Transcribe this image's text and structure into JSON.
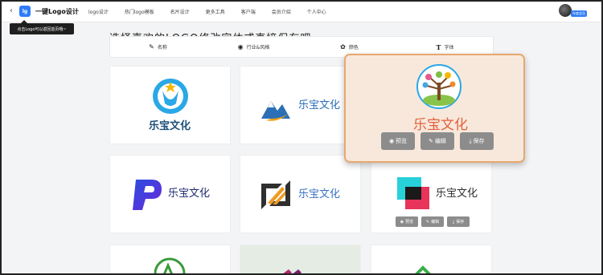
{
  "header": {
    "back_icon": "chevron-left-icon",
    "brand_badge": "lg",
    "brand": "一键Logo设计",
    "nav": [
      "logo设计",
      "热门logo模板",
      "名片设计",
      "更多工具",
      "客户端",
      "会员介绍",
      "个人中心"
    ],
    "vip_badge": "年度会员"
  },
  "tooltip": "点击Logo可以返回首页哦~",
  "heading": "选择喜欢的LOGO修改字体或直接保存吧",
  "tabs": [
    {
      "icon": "pen-icon",
      "label": "名称"
    },
    {
      "icon": "compass-icon",
      "label": "行业&风格"
    },
    {
      "icon": "palette-icon",
      "label": "颜色"
    },
    {
      "icon": "text-icon",
      "label": "字体"
    }
  ],
  "cards": [
    {
      "name": "乐宝文化",
      "color": "#1e4f7a"
    },
    {
      "name": "乐宝文化",
      "color": "#2b6fb6"
    },
    {
      "name": "乐宝文化",
      "color": "#e2613a"
    },
    {
      "name": "乐宝文化",
      "color": "#1f2a6e"
    },
    {
      "name": "乐宝文化",
      "color": "#3c72c0"
    },
    {
      "name": "乐宝文化",
      "color": "#303030"
    }
  ],
  "actions": {
    "preview": "预览",
    "edit": "编辑",
    "save": "保存"
  }
}
